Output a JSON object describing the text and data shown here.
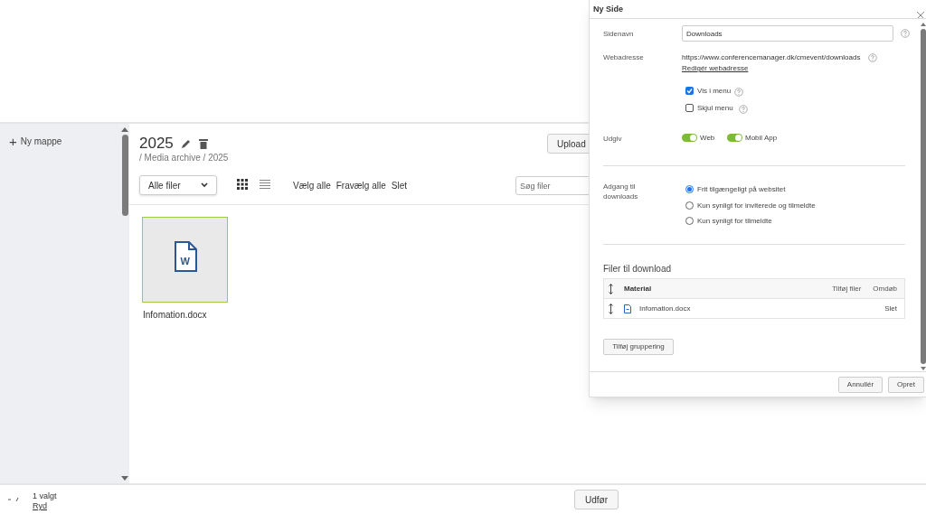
{
  "sidebar": {
    "new_folder": {
      "icon": "+",
      "label": "Ny mappe"
    }
  },
  "folder": {
    "title": "2025",
    "breadcrumb": "/ Media archive / 2025",
    "upload_button": "Upload"
  },
  "toolbar": {
    "filter": "Alle filer",
    "view_grid_selected": true,
    "actions": [
      "Vælg alle",
      "Fravælg alle",
      "Slet"
    ],
    "search_placeholder": "Søg filer"
  },
  "files": [
    {
      "name": "Infomation.docx",
      "selected": true,
      "type_letter": "W"
    }
  ],
  "bottom_bar": {
    "count": "1 valgt",
    "clear_link": "Ryd",
    "run_button": "Udfør"
  },
  "dialog": {
    "title": "Ny Side",
    "page_name": {
      "label": "Sidenavn",
      "value": "Downloads"
    },
    "web_address": {
      "label": "Webadresse",
      "url": "https://www.conferencemanager.dk/cmevent/downloads",
      "edit_link": "Redigér webadresse"
    },
    "menu_options": [
      {
        "label": "Vis i menu",
        "checked": true
      },
      {
        "label": "Skjul menu",
        "checked": false
      }
    ],
    "publish": {
      "label": "Udgiv",
      "toggles": [
        {
          "label": "Web",
          "on": true
        },
        {
          "label": "Mobil App",
          "on": true
        }
      ]
    },
    "access": {
      "label": "Adgang til downloads",
      "options": [
        {
          "label": "Frit tilgængeligt på websitet",
          "selected": true
        },
        {
          "label": "Kun synligt for inviterede og tilmeldte",
          "selected": false
        },
        {
          "label": "Kun synligt for tilmeldte",
          "selected": false
        }
      ]
    },
    "files_section": {
      "heading": "Filer til download",
      "columns": [
        "Material",
        "Tilføj filer",
        "Omdøb"
      ],
      "rows": [
        {
          "name": "Infomation.docx",
          "action": "Slet"
        }
      ],
      "add_group_button": "Tilføj gruppering"
    },
    "buttons": [
      "Annullér",
      "Opret"
    ]
  }
}
